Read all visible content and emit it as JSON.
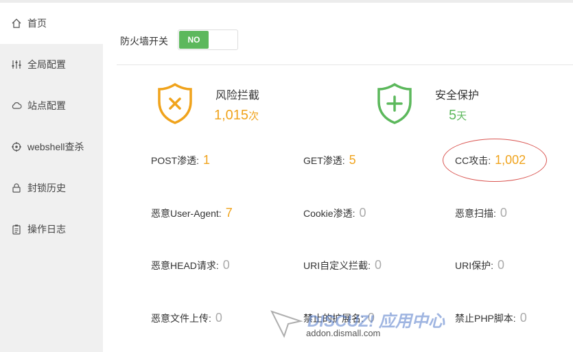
{
  "sidebar": {
    "items": [
      {
        "label": "首页",
        "icon": "home-icon"
      },
      {
        "label": "全局配置",
        "icon": "sliders-icon"
      },
      {
        "label": "站点配置",
        "icon": "cloud-icon"
      },
      {
        "label": "webshell查杀",
        "icon": "target-icon"
      },
      {
        "label": "封锁历史",
        "icon": "lock-icon"
      },
      {
        "label": "操作日志",
        "icon": "clipboard-icon"
      }
    ]
  },
  "firewall": {
    "label": "防火墙开关",
    "toggle": "NO"
  },
  "summary": {
    "risk": {
      "title": "风险拦截",
      "count": "1,015",
      "unit": "次"
    },
    "safe": {
      "title": "安全保护",
      "count": "5",
      "unit": "天"
    }
  },
  "metrics": {
    "post": {
      "label": "POST渗透:",
      "value": "1"
    },
    "get": {
      "label": "GET渗透:",
      "value": "5"
    },
    "cc": {
      "label": "CC攻击:",
      "value": "1,002"
    },
    "ua": {
      "label": "恶意User-Agent:",
      "value": "7"
    },
    "cookie": {
      "label": "Cookie渗透:",
      "value": "0"
    },
    "scan": {
      "label": "恶意扫描:",
      "value": "0"
    },
    "head": {
      "label": "恶意HEAD请求:",
      "value": "0"
    },
    "uri_custom": {
      "label": "URI自定义拦截:",
      "value": "0"
    },
    "uri_protect": {
      "label": "URI保护:",
      "value": "0"
    },
    "upload": {
      "label": "恶意文件上传:",
      "value": "0"
    },
    "ext": {
      "label": "禁止的扩展名:",
      "value": "0"
    },
    "php": {
      "label": "禁止PHP脚本:",
      "value": "0"
    }
  },
  "watermark": {
    "brand": "DISCUZ! 应用中心",
    "url": "addon.dismall.com"
  },
  "colors": {
    "accent": "#f0a31c",
    "success": "#5cb85c",
    "highlight": "#d9534f"
  }
}
